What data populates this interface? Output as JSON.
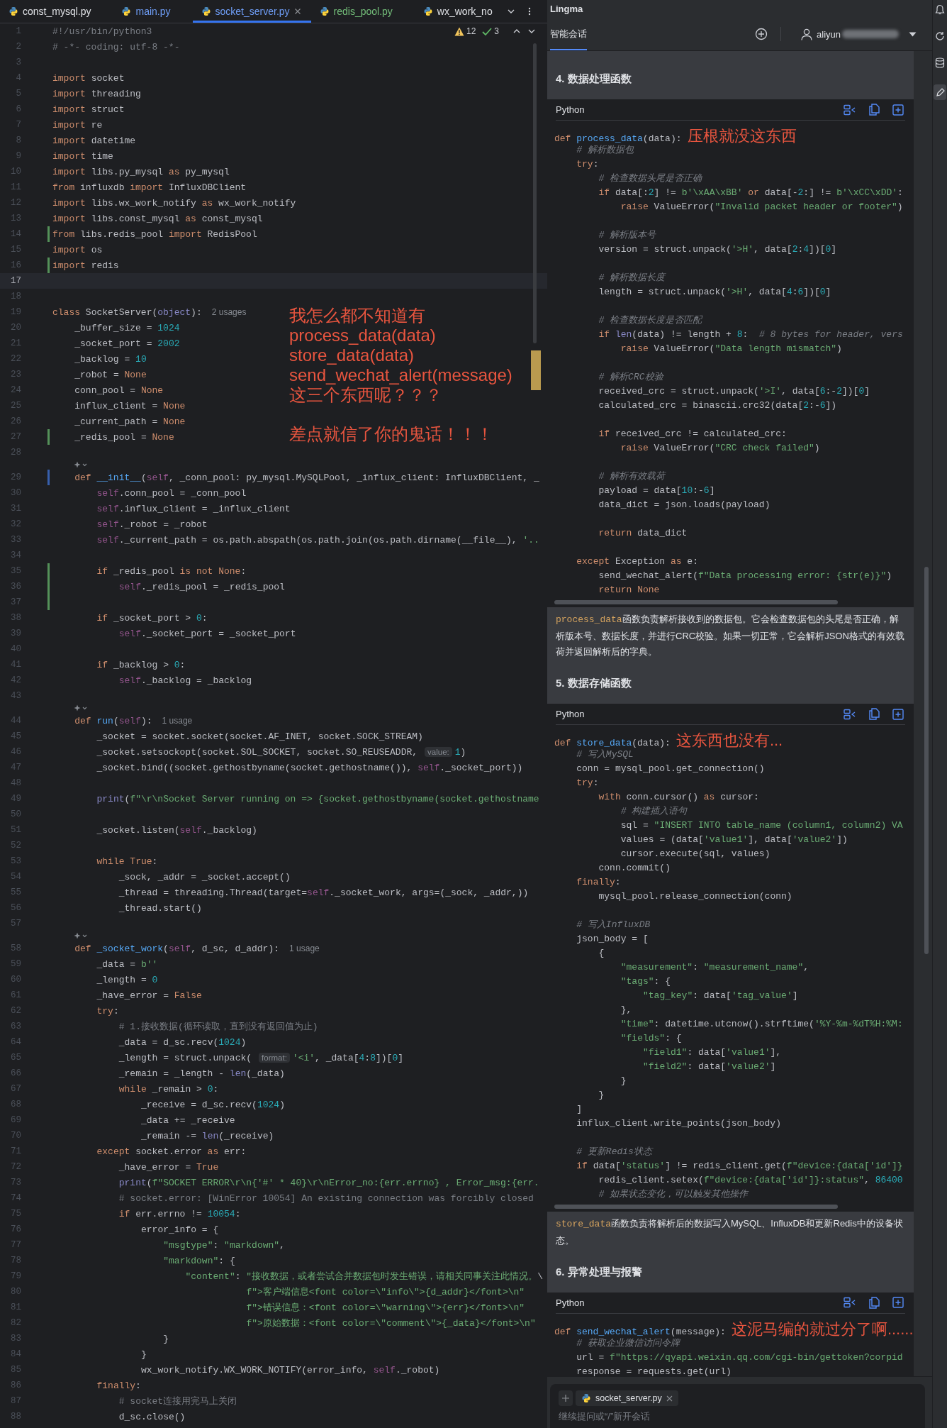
{
  "editor": {
    "tabs": [
      {
        "label": "const_mysql.py",
        "selected": false,
        "color": "#dfe1e5"
      },
      {
        "label": "main.py",
        "selected": false,
        "color": "#6f9ef7"
      },
      {
        "label": "socket_server.py",
        "selected": true,
        "color": "#6f9ef7"
      },
      {
        "label": "redis_pool.py",
        "selected": false,
        "color": "#73bd79"
      },
      {
        "label": "wx_work_no",
        "selected": false,
        "color": "#dfe1e5"
      }
    ],
    "inspections": {
      "warnings": "12",
      "passed": "3"
    },
    "lines": [
      {
        "kind": "line",
        "n": "1",
        "code": "#!/usr/bin/python3"
      },
      {
        "kind": "line",
        "n": "2",
        "code": "# -*- coding: utf-8 -*-"
      },
      {
        "kind": "line",
        "n": "3"
      },
      {
        "kind": "line",
        "n": "4",
        "code": "import socket"
      },
      {
        "kind": "line",
        "n": "5",
        "code": "import threading"
      },
      {
        "kind": "line",
        "n": "6",
        "code": "import struct"
      },
      {
        "kind": "line",
        "n": "7",
        "code": "import re"
      },
      {
        "kind": "line",
        "n": "8",
        "code": "import datetime"
      },
      {
        "kind": "line",
        "n": "9",
        "code": "import time"
      },
      {
        "kind": "line",
        "n": "10",
        "code": "import libs.py_mysql as py_mysql"
      },
      {
        "kind": "line",
        "n": "11",
        "code": "from influxdb import InfluxDBClient"
      },
      {
        "kind": "line",
        "n": "12",
        "code": "import libs.wx_work_notify as wx_work_notify"
      },
      {
        "kind": "line",
        "n": "13",
        "code": "import libs.const_mysql as const_mysql"
      },
      {
        "kind": "line",
        "n": "14",
        "code": "from libs.redis_pool import RedisPool",
        "color": "#549159"
      },
      {
        "kind": "line",
        "n": "15",
        "code": "import os"
      },
      {
        "kind": "line",
        "n": "16",
        "code": "import redis",
        "color": "#549159"
      },
      {
        "kind": "current",
        "n": "17"
      },
      {
        "kind": "line",
        "n": "18"
      },
      {
        "kind": "line",
        "n": "19",
        "code": "class SocketServer(object):",
        "hint": "2 usages"
      },
      {
        "kind": "line",
        "n": "20",
        "code": "    _buffer_size = 1024"
      },
      {
        "kind": "line",
        "n": "21",
        "code": "    _socket_port = 2002"
      },
      {
        "kind": "line",
        "n": "22",
        "code": "    _backlog = 10"
      },
      {
        "kind": "line",
        "n": "23",
        "code": "    _robot = None"
      },
      {
        "kind": "line",
        "n": "24",
        "code": "    conn_pool = None"
      },
      {
        "kind": "line",
        "n": "25",
        "code": "    influx_client = None"
      },
      {
        "kind": "line",
        "n": "26",
        "code": "    _current_path = None"
      },
      {
        "kind": "line",
        "n": "27",
        "code": "    _redis_pool = None",
        "color": "#549159"
      },
      {
        "kind": "line",
        "n": "28"
      },
      {
        "kind": "lens"
      },
      {
        "kind": "line",
        "n": "29",
        "code": "    def __init__(self, _conn_pool: py_mysql.MySQLPool, _influx_client: InfluxDBClient, _",
        "color": "#375fad"
      },
      {
        "kind": "line",
        "n": "30",
        "code": "        self.conn_pool = _conn_pool"
      },
      {
        "kind": "line",
        "n": "31",
        "code": "        self.influx_client = _influx_client"
      },
      {
        "kind": "line",
        "n": "32",
        "code": "        self._robot = _robot"
      },
      {
        "kind": "line",
        "n": "33",
        "code": "        self._current_path = os.path.abspath(os.path.join(os.path.dirname(__file__), '.."
      },
      {
        "kind": "line",
        "n": "34"
      },
      {
        "kind": "line",
        "n": "35",
        "code": "        if _redis_pool is not None:",
        "color": "#549159"
      },
      {
        "kind": "line",
        "n": "36",
        "code": "            self._redis_pool = _redis_pool",
        "color": "#549159"
      },
      {
        "kind": "line",
        "n": "37",
        "color": "#549159"
      },
      {
        "kind": "line",
        "n": "38",
        "code": "        if _socket_port > 0:"
      },
      {
        "kind": "line",
        "n": "39",
        "code": "            self._socket_port = _socket_port"
      },
      {
        "kind": "line",
        "n": "40"
      },
      {
        "kind": "line",
        "n": "41",
        "code": "        if _backlog > 0:"
      },
      {
        "kind": "line",
        "n": "42",
        "code": "            self._backlog = _backlog"
      },
      {
        "kind": "line",
        "n": "43"
      },
      {
        "kind": "lens"
      },
      {
        "kind": "line",
        "n": "44",
        "code": "    def run(self):",
        "hint": "1 usage"
      },
      {
        "kind": "line",
        "n": "45",
        "code": "        _socket = socket.socket(socket.AF_INET, socket.SOCK_STREAM)"
      },
      {
        "kind": "line",
        "n": "46",
        "code": "        _socket.setsockopt(socket.SOL_SOCKET, socket.SO_REUSEADDR,",
        "param_hint": "value:",
        "code_after": "1)"
      },
      {
        "kind": "line",
        "n": "47",
        "code": "        _socket.bind((socket.gethostbyname(socket.gethostname()), self._socket_port))"
      },
      {
        "kind": "line",
        "n": "48"
      },
      {
        "kind": "line",
        "n": "49",
        "code": "        print(f\"\\r\\nSocket Server running on => {socket.gethostbyname(socket.gethostname"
      },
      {
        "kind": "line",
        "n": "50"
      },
      {
        "kind": "line",
        "n": "51",
        "code": "        _socket.listen(self._backlog)"
      },
      {
        "kind": "line",
        "n": "52"
      },
      {
        "kind": "line",
        "n": "53",
        "code": "        while True:"
      },
      {
        "kind": "line",
        "n": "54",
        "code": "            _sock, _addr = _socket.accept()"
      },
      {
        "kind": "line",
        "n": "55",
        "code": "            _thread = threading.Thread(target=self._socket_work, args=(_sock, _addr,))"
      },
      {
        "kind": "line",
        "n": "56",
        "code": "            _thread.start()"
      },
      {
        "kind": "line",
        "n": "57"
      },
      {
        "kind": "lens"
      },
      {
        "kind": "line",
        "n": "58",
        "code": "    def _socket_work(self, d_sc, d_addr):",
        "hint": "1 usage"
      },
      {
        "kind": "line",
        "n": "59",
        "code": "        _data = b''"
      },
      {
        "kind": "line",
        "n": "60",
        "code": "        _length = 0"
      },
      {
        "kind": "line",
        "n": "61",
        "code": "        _have_error = False"
      },
      {
        "kind": "line",
        "n": "62",
        "code": "        try:"
      },
      {
        "kind": "line",
        "n": "63",
        "code": "            # 1.接收数据(循环读取，直到没有返回值为止)"
      },
      {
        "kind": "line",
        "n": "64",
        "code": "            _data = d_sc.recv(1024)"
      },
      {
        "kind": "line",
        "n": "65",
        "code": "            _length = struct.unpack(",
        "param_hint": "format:",
        "code_after": "'<i', _data[4:8])[0]"
      },
      {
        "kind": "line",
        "n": "66",
        "code": "            _remain = _length - len(_data)"
      },
      {
        "kind": "line",
        "n": "67",
        "code": "            while _remain > 0:"
      },
      {
        "kind": "line",
        "n": "68",
        "code": "                _receive = d_sc.recv(1024)"
      },
      {
        "kind": "line",
        "n": "69",
        "code": "                _data += _receive"
      },
      {
        "kind": "line",
        "n": "70",
        "code": "                _remain -= len(_receive)"
      },
      {
        "kind": "line",
        "n": "71",
        "code": "        except socket.error as err:"
      },
      {
        "kind": "line",
        "n": "72",
        "code": "            _have_error = True"
      },
      {
        "kind": "line",
        "n": "73",
        "code": "            print(f\"SOCKET ERROR\\r\\n{'#' * 40}\\r\\nError_no:{err.errno} , Error_msg:{err."
      },
      {
        "kind": "line",
        "n": "74",
        "code": "            # socket.error: [WinError 10054] An existing connection was forcibly closed"
      },
      {
        "kind": "line",
        "n": "75",
        "code": "            if err.errno != 10054:"
      },
      {
        "kind": "line",
        "n": "76",
        "code": "                error_info = {"
      },
      {
        "kind": "line",
        "n": "77",
        "code": "                    \"msgtype\": \"markdown\","
      },
      {
        "kind": "line",
        "n": "78",
        "code": "                    \"markdown\": {"
      },
      {
        "kind": "line",
        "n": "79",
        "code": "                        \"content\": \"接收数据，或者尝试合并数据包时发生错误，请相关同事关注此情况。\\"
      },
      {
        "kind": "line",
        "n": "80",
        "code": "                                   f\">客户端信息<font color=\\\"info\\\">{d_addr}</font>\\n\""
      },
      {
        "kind": "line",
        "n": "81",
        "code": "                                   f\">错误信息：<font color=\\\"warning\\\">{err}</font>\\n\""
      },
      {
        "kind": "line",
        "n": "82",
        "code": "                                   f\">原始数据：<font color=\\\"comment\\\">{_data}</font>\\n\""
      },
      {
        "kind": "line",
        "n": "83",
        "code": "                    }"
      },
      {
        "kind": "line",
        "n": "84",
        "code": "                }"
      },
      {
        "kind": "line",
        "n": "85",
        "code": "                wx_work_notify.WX_WORK_NOTIFY(error_info, self._robot)"
      },
      {
        "kind": "line",
        "n": "86",
        "code": "        finally:"
      },
      {
        "kind": "line",
        "n": "87",
        "code": "            # socket连接用完马上关闭"
      },
      {
        "kind": "line",
        "n": "88",
        "code": "            d_sc.close()"
      }
    ],
    "annotation": {
      "lines": [
        "我怎么都不知道有",
        "process_data(data)",
        "store_data(data)",
        "send_wechat_alert(message)",
        "这三个东西呢？？？"
      ],
      "footer": "差点就信了你的鬼话！！！"
    }
  },
  "assistant": {
    "title": "Lingma",
    "tabs": [
      {
        "label": "智能会话",
        "selected": true
      }
    ],
    "account": "aliyun",
    "sections": [
      {
        "kind": "heading",
        "text": "4. 数据处理函数"
      },
      {
        "kind": "code",
        "language": "Python",
        "lines": [
          {
            "code": "def process_data(data):",
            "note": "压根就没这东西"
          },
          {
            "code": "    # 解析数据包"
          },
          {
            "code": "    try:"
          },
          {
            "code": "        # 检查数据头尾是否正确"
          },
          {
            "code": "        if data[:2] != b'\\xAA\\xBB' or data[-2:] != b'\\xCC\\xDD':"
          },
          {
            "code": "            raise ValueError(\"Invalid packet header or footer\")"
          },
          {
            "kind": "blank"
          },
          {
            "code": "        # 解析版本号"
          },
          {
            "code": "        version = struct.unpack('>H', data[2:4])[0]"
          },
          {
            "kind": "blank"
          },
          {
            "code": "        # 解析数据长度"
          },
          {
            "code": "        length = struct.unpack('>H', data[4:6])[0]"
          },
          {
            "kind": "blank"
          },
          {
            "code": "        # 检查数据长度是否匹配"
          },
          {
            "code": "        if len(data) != length + 8:  # 8 bytes for header, vers"
          },
          {
            "code": "            raise ValueError(\"Data length mismatch\")"
          },
          {
            "kind": "blank"
          },
          {
            "code": "        # 解析CRC校验"
          },
          {
            "code": "        received_crc = struct.unpack('>I', data[6:-2])[0]"
          },
          {
            "code": "        calculated_crc = binascii.crc32(data[2:-6])"
          },
          {
            "kind": "blank"
          },
          {
            "code": "        if received_crc != calculated_crc:"
          },
          {
            "code": "            raise ValueError(\"CRC check failed\")"
          },
          {
            "kind": "blank"
          },
          {
            "code": "        # 解析有效载荷"
          },
          {
            "code": "        payload = data[10:-6]"
          },
          {
            "code": "        data_dict = json.loads(payload)"
          },
          {
            "kind": "blank"
          },
          {
            "code": "        return data_dict"
          },
          {
            "kind": "blank"
          },
          {
            "code": "    except Exception as e:"
          },
          {
            "code": "        send_wechat_alert(f\"Data processing error: {str(e)}\")"
          },
          {
            "code": "        return None"
          }
        ]
      },
      {
        "kind": "paragraph",
        "code_term": "process_data",
        "text": "函数负责解析接收到的数据包。它会检查数据包的头尾是否正确，解析版本号、数据长度，并进行CRC校验。如果一切正常，它会解析JSON格式的有效载荷并返回解析后的字典。"
      },
      {
        "kind": "heading",
        "text": "5. 数据存储函数"
      },
      {
        "kind": "code",
        "language": "Python",
        "lines": [
          {
            "code": "def store_data(data):",
            "note": "这东西也没有..."
          },
          {
            "code": "    # 写入MySQL"
          },
          {
            "code": "    conn = mysql_pool.get_connection()"
          },
          {
            "code": "    try:"
          },
          {
            "code": "        with conn.cursor() as cursor:"
          },
          {
            "code": "            # 构建插入语句"
          },
          {
            "code": "            sql = \"INSERT INTO table_name (column1, column2) VA"
          },
          {
            "code": "            values = (data['value1'], data['value2'])"
          },
          {
            "code": "            cursor.execute(sql, values)"
          },
          {
            "code": "        conn.commit()"
          },
          {
            "code": "    finally:"
          },
          {
            "code": "        mysql_pool.release_connection(conn)"
          },
          {
            "kind": "blank"
          },
          {
            "code": "    # 写入InfluxDB"
          },
          {
            "code": "    json_body = ["
          },
          {
            "code": "        {"
          },
          {
            "code": "            \"measurement\": \"measurement_name\","
          },
          {
            "code": "            \"tags\": {"
          },
          {
            "code": "                \"tag_key\": data['tag_value']"
          },
          {
            "code": "            },"
          },
          {
            "code": "            \"time\": datetime.utcnow().strftime('%Y-%m-%dT%H:%M:"
          },
          {
            "code": "            \"fields\": {"
          },
          {
            "code": "                \"field1\": data['value1'],"
          },
          {
            "code": "                \"field2\": data['value2']"
          },
          {
            "code": "            }"
          },
          {
            "code": "        }"
          },
          {
            "code": "    ]"
          },
          {
            "code": "    influx_client.write_points(json_body)"
          },
          {
            "kind": "blank"
          },
          {
            "code": "    # 更新Redis状态"
          },
          {
            "code": "    if data['status'] != redis_client.get(f\"device:{data['id']}"
          },
          {
            "code": "        redis_client.setex(f\"device:{data['id']}:status\", 86400"
          },
          {
            "code": "        # 如果状态变化，可以触发其他操作"
          }
        ]
      },
      {
        "kind": "paragraph",
        "code_term": "store_data",
        "text": "函数负责将解析后的数据写入MySQL、InfluxDB和更新Redis中的设备状态。"
      },
      {
        "kind": "heading",
        "text": "6. 异常处理与报警"
      },
      {
        "kind": "code",
        "language": "Python",
        "lines": [
          {
            "code": "def send_wechat_alert(message):",
            "note": "这泥马编的就过分了啊......"
          },
          {
            "code": "    # 获取企业微信访问令牌"
          },
          {
            "code": "    url = f\"https://qyapi.weixin.qq.com/cgi-bin/gettoken?corpid"
          },
          {
            "code": "    response = requests.get(url)"
          }
        ]
      }
    ],
    "input": {
      "attachment": "socket_server.py",
      "placeholder": "继续提问或“/”新开会话"
    }
  }
}
